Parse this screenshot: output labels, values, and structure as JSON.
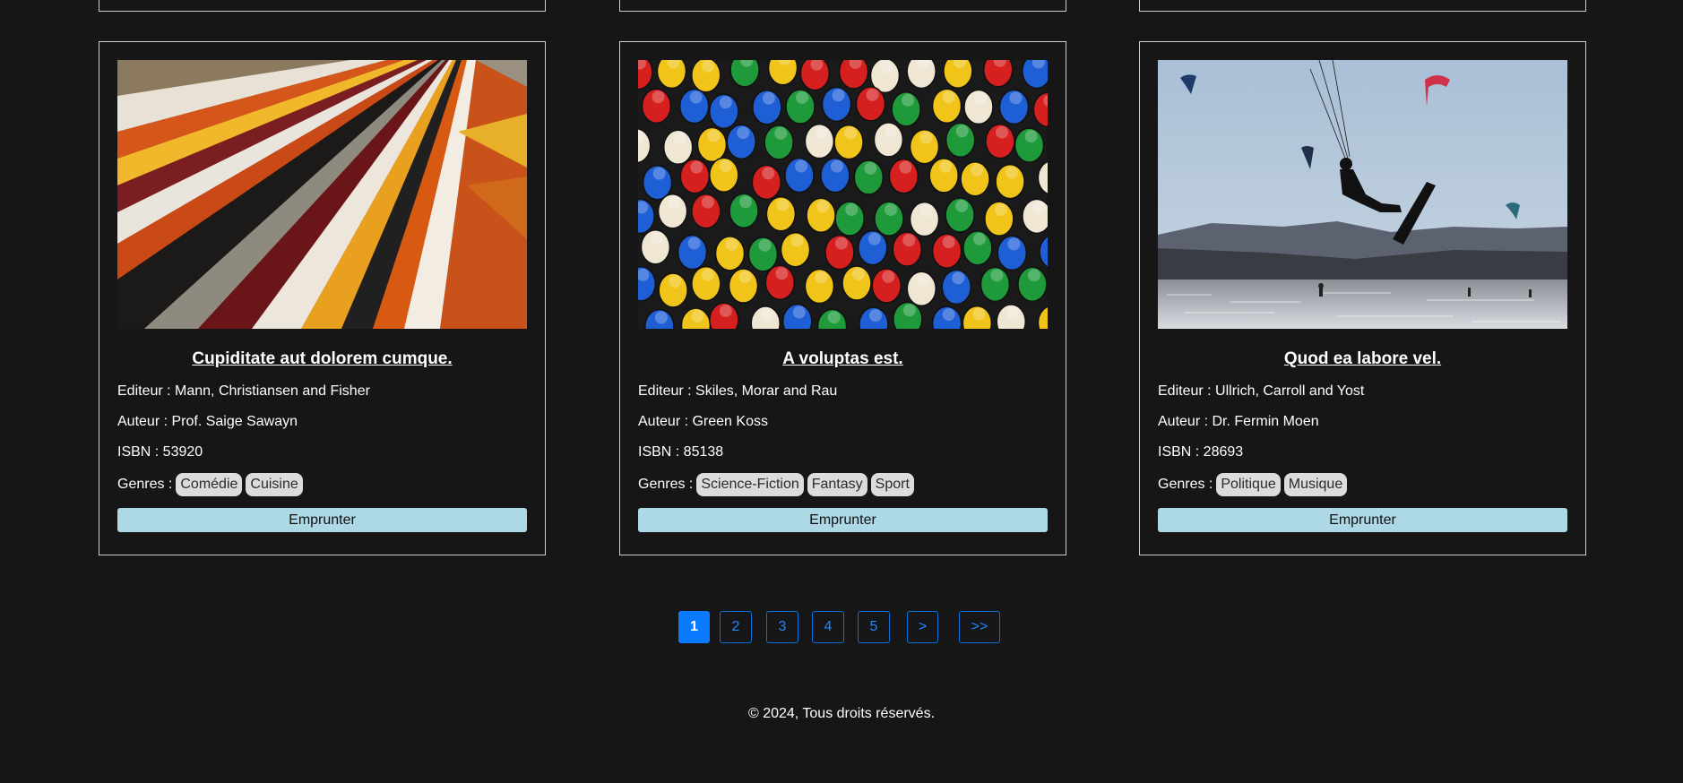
{
  "books": [
    {
      "title": "Cupiditate aut dolorem cumque.",
      "editeur": "Editeur : Mann, Christiansen and Fisher",
      "auteur": "Auteur : Prof. Saige Sawayn",
      "isbn": "ISBN : 53920",
      "genres_label": "Genres :",
      "genres": [
        "Comédie",
        "Cuisine"
      ],
      "borrow_label": "Emprunter"
    },
    {
      "title": "A voluptas est.",
      "editeur": "Editeur : Skiles, Morar and Rau",
      "auteur": "Auteur : Green Koss",
      "isbn": "ISBN : 85138",
      "genres_label": "Genres :",
      "genres": [
        "Science-Fiction",
        "Fantasy",
        "Sport"
      ],
      "borrow_label": "Emprunter"
    },
    {
      "title": "Quod ea labore vel.",
      "editeur": "Editeur : Ullrich, Carroll and Yost",
      "auteur": "Auteur : Dr. Fermin Moen",
      "isbn": "ISBN : 28693",
      "genres_label": "Genres :",
      "genres": [
        "Politique",
        "Musique"
      ],
      "borrow_label": "Emprunter"
    }
  ],
  "pagination": {
    "pages": [
      "1",
      "2",
      "3",
      "4",
      "5"
    ],
    "next": ">",
    "last": ">>",
    "current": "1"
  },
  "footer": {
    "text": "© 2024, Tous droits réservés."
  },
  "colors": {
    "background": "#161616",
    "button": "#add8e6",
    "pager_accent": "#0a7bff"
  }
}
